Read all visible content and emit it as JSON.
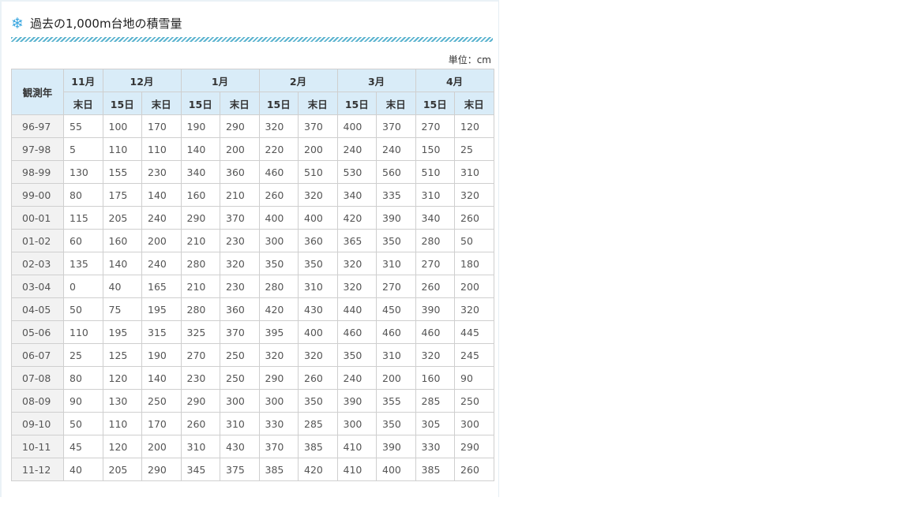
{
  "page": {
    "title": "過去の1,000m台地の積雪量",
    "unit_label": "単位：cm",
    "icon": "snowflake-icon",
    "accent_color": "#3aa7e0"
  },
  "table": {
    "year_header": "観測年",
    "months": [
      "11月",
      "12月",
      "1月",
      "2月",
      "3月",
      "4月"
    ],
    "sub_headers": [
      "末日",
      "15日",
      "末日",
      "15日",
      "末日",
      "15日",
      "末日",
      "15日",
      "末日",
      "15日",
      "末日"
    ],
    "rows": [
      {
        "year": "96-97",
        "values": [
          "55",
          "100",
          "170",
          "190",
          "290",
          "320",
          "370",
          "400",
          "370",
          "270",
          "120"
        ]
      },
      {
        "year": "97-98",
        "values": [
          "5",
          "110",
          "110",
          "140",
          "200",
          "220",
          "200",
          "240",
          "240",
          "150",
          "25"
        ]
      },
      {
        "year": "98-99",
        "values": [
          "130",
          "155",
          "230",
          "340",
          "360",
          "460",
          "510",
          "530",
          "560",
          "510",
          "310"
        ]
      },
      {
        "year": "99-00",
        "values": [
          "80",
          "175",
          "140",
          "160",
          "210",
          "260",
          "320",
          "340",
          "335",
          "310",
          "320"
        ]
      },
      {
        "year": "00-01",
        "values": [
          "115",
          "205",
          "240",
          "290",
          "370",
          "400",
          "400",
          "420",
          "390",
          "340",
          "260"
        ]
      },
      {
        "year": "01-02",
        "values": [
          "60",
          "160",
          "200",
          "210",
          "230",
          "300",
          "360",
          "365",
          "350",
          "280",
          "50"
        ]
      },
      {
        "year": "02-03",
        "values": [
          "135",
          "140",
          "240",
          "280",
          "320",
          "350",
          "350",
          "320",
          "310",
          "270",
          "180"
        ]
      },
      {
        "year": "03-04",
        "values": [
          "0",
          "40",
          "165",
          "210",
          "230",
          "280",
          "310",
          "320",
          "270",
          "260",
          "200"
        ]
      },
      {
        "year": "04-05",
        "values": [
          "50",
          "75",
          "195",
          "280",
          "360",
          "420",
          "430",
          "440",
          "450",
          "390",
          "320"
        ]
      },
      {
        "year": "05-06",
        "values": [
          "110",
          "195",
          "315",
          "325",
          "370",
          "395",
          "400",
          "460",
          "460",
          "460",
          "445"
        ]
      },
      {
        "year": "06-07",
        "values": [
          "25",
          "125",
          "190",
          "270",
          "250",
          "320",
          "320",
          "350",
          "310",
          "320",
          "245"
        ]
      },
      {
        "year": "07-08",
        "values": [
          "80",
          "120",
          "140",
          "230",
          "250",
          "290",
          "260",
          "240",
          "200",
          "160",
          "90"
        ]
      },
      {
        "year": "08-09",
        "values": [
          "90",
          "130",
          "250",
          "290",
          "300",
          "300",
          "350",
          "390",
          "355",
          "285",
          "250"
        ]
      },
      {
        "year": "09-10",
        "values": [
          "50",
          "110",
          "170",
          "260",
          "310",
          "330",
          "285",
          "300",
          "350",
          "305",
          "300"
        ]
      },
      {
        "year": "10-11",
        "values": [
          "45",
          "120",
          "200",
          "310",
          "430",
          "370",
          "385",
          "410",
          "390",
          "330",
          "290"
        ]
      },
      {
        "year": "11-12",
        "values": [
          "40",
          "205",
          "290",
          "345",
          "375",
          "385",
          "420",
          "410",
          "400",
          "385",
          "260"
        ]
      }
    ]
  }
}
